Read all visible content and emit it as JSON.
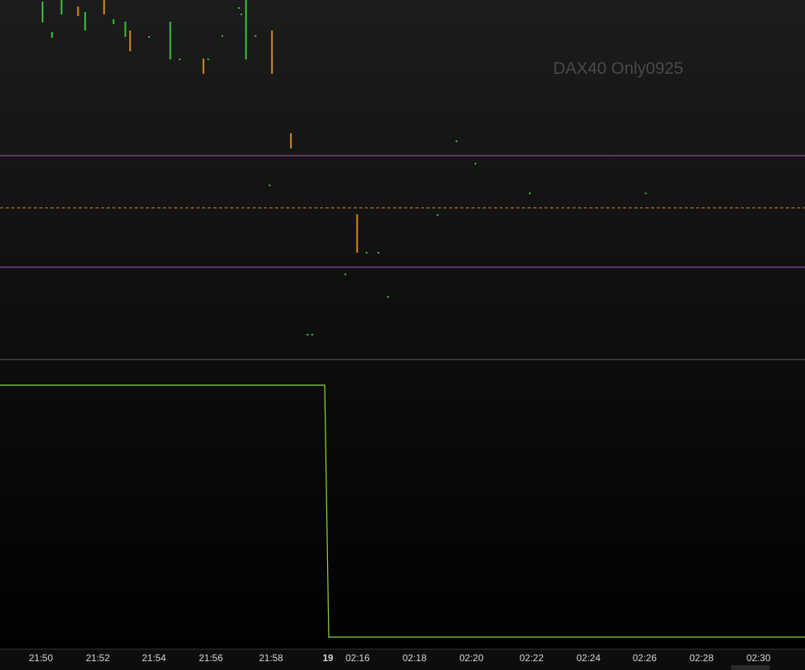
{
  "chart_data": {
    "type": "bar",
    "watermark": "DAX40 Only0925",
    "x_tick_labels": [
      "21:50",
      "21:52",
      "21:54",
      "21:56",
      "21:58",
      "19",
      "02:16",
      "02:18",
      "02:20",
      "02:22",
      "02:24",
      "02:26",
      "02:28",
      "02:30"
    ],
    "session_break_label": "19",
    "price_pane": {
      "horizontal_lines": [
        {
          "kind": "solid",
          "color": "#b04fc4",
          "level": "upper"
        },
        {
          "kind": "dashed",
          "color": "#e08a2a",
          "level": "middle"
        },
        {
          "kind": "solid",
          "color": "#b04fc4",
          "level": "lower"
        }
      ],
      "bars": [
        {
          "slot": 1.8,
          "hi": 2,
          "lo": 28,
          "color": "#39c43a"
        },
        {
          "slot": 2.2,
          "hi": 40,
          "lo": 47,
          "color": "#39c43a"
        },
        {
          "slot": 2.6,
          "hi": -5,
          "lo": 18,
          "color": "#39c43a"
        },
        {
          "slot": 3.3,
          "hi": 8,
          "lo": 20,
          "color": "#d98b1e"
        },
        {
          "slot": 3.6,
          "hi": 15,
          "lo": 38,
          "color": "#39c43a"
        },
        {
          "slot": 4.4,
          "hi": -5,
          "lo": 18,
          "color": "#d98b1e"
        },
        {
          "slot": 4.8,
          "hi": 24,
          "lo": 30,
          "color": "#39c43a"
        },
        {
          "slot": 5.3,
          "hi": 27,
          "lo": 46,
          "color": "#39c43a"
        },
        {
          "slot": 5.5,
          "hi": 38,
          "lo": 64,
          "color": "#d98b1e"
        },
        {
          "slot": 6.3,
          "hi": 45,
          "lo": 47,
          "color": "#39c43a"
        },
        {
          "slot": 7.2,
          "hi": 27,
          "lo": 74,
          "color": "#39c43a"
        },
        {
          "slot": 7.6,
          "hi": 73,
          "lo": 75,
          "color": "#39c43a"
        },
        {
          "slot": 8.6,
          "hi": 73,
          "lo": 92,
          "color": "#d98b1e"
        },
        {
          "slot": 8.8,
          "hi": 73,
          "lo": 75,
          "color": "#39c43a"
        },
        {
          "slot": 9.4,
          "hi": 44,
          "lo": 46,
          "color": "#39c43a"
        },
        {
          "slot": 10.1,
          "hi": 9,
          "lo": 11,
          "color": "#39c43a"
        },
        {
          "slot": 10.2,
          "hi": 17,
          "lo": 19,
          "color": "#39c43a"
        },
        {
          "slot": 10.4,
          "hi": 0,
          "lo": 74,
          "color": "#39c43a"
        },
        {
          "slot": 10.8,
          "hi": 44,
          "lo": 46,
          "color": "#39c43a"
        },
        {
          "slot": 11.4,
          "hi": 230,
          "lo": 232,
          "color": "#39c43a"
        },
        {
          "slot": 11.5,
          "hi": 38,
          "lo": 92,
          "color": "#d98b1e"
        },
        {
          "slot": 12.3,
          "hi": 166,
          "lo": 185,
          "color": "#d98b1e"
        },
        {
          "slot": 13.0,
          "hi": 416,
          "lo": 418,
          "color": "#39c43a"
        },
        {
          "slot": 13.2,
          "hi": 416,
          "lo": 418,
          "color": "#39c43a"
        },
        {
          "slot": 14.6,
          "hi": 341,
          "lo": 343,
          "color": "#39c43a"
        },
        {
          "slot": 15.1,
          "hi": 267,
          "lo": 315,
          "color": "#d98b1e"
        },
        {
          "slot": 15.5,
          "hi": 314,
          "lo": 316,
          "color": "#39c43a"
        },
        {
          "slot": 16.0,
          "hi": 314,
          "lo": 316,
          "color": "#39c43a"
        },
        {
          "slot": 16.4,
          "hi": 369,
          "lo": 371,
          "color": "#39c43a"
        },
        {
          "slot": 18.5,
          "hi": 267,
          "lo": 269,
          "color": "#39c43a"
        },
        {
          "slot": 19.3,
          "hi": 175,
          "lo": 177,
          "color": "#39c43a"
        },
        {
          "slot": 20.1,
          "hi": 203,
          "lo": 205,
          "color": "#39c43a"
        },
        {
          "slot": 22.4,
          "hi": 240,
          "lo": 242,
          "color": "#39c43a"
        },
        {
          "slot": 27.3,
          "hi": 240,
          "lo": 242,
          "color": "#39c43a"
        }
      ]
    },
    "indicator_pane": {
      "series": [
        {
          "color": "#8fdc3c",
          "steps": [
            {
              "from": 0,
              "to": 405,
              "level": "high"
            },
            {
              "from": 410,
              "to": 1004,
              "level": "low"
            }
          ]
        }
      ]
    },
    "grid": false,
    "colors": {
      "background_top": "#1c1c1c",
      "background_bottom": "#000000",
      "separator": "#5a5a5a",
      "axis_text": "#d7d7d7",
      "watermark": "#4a4a4a"
    }
  }
}
